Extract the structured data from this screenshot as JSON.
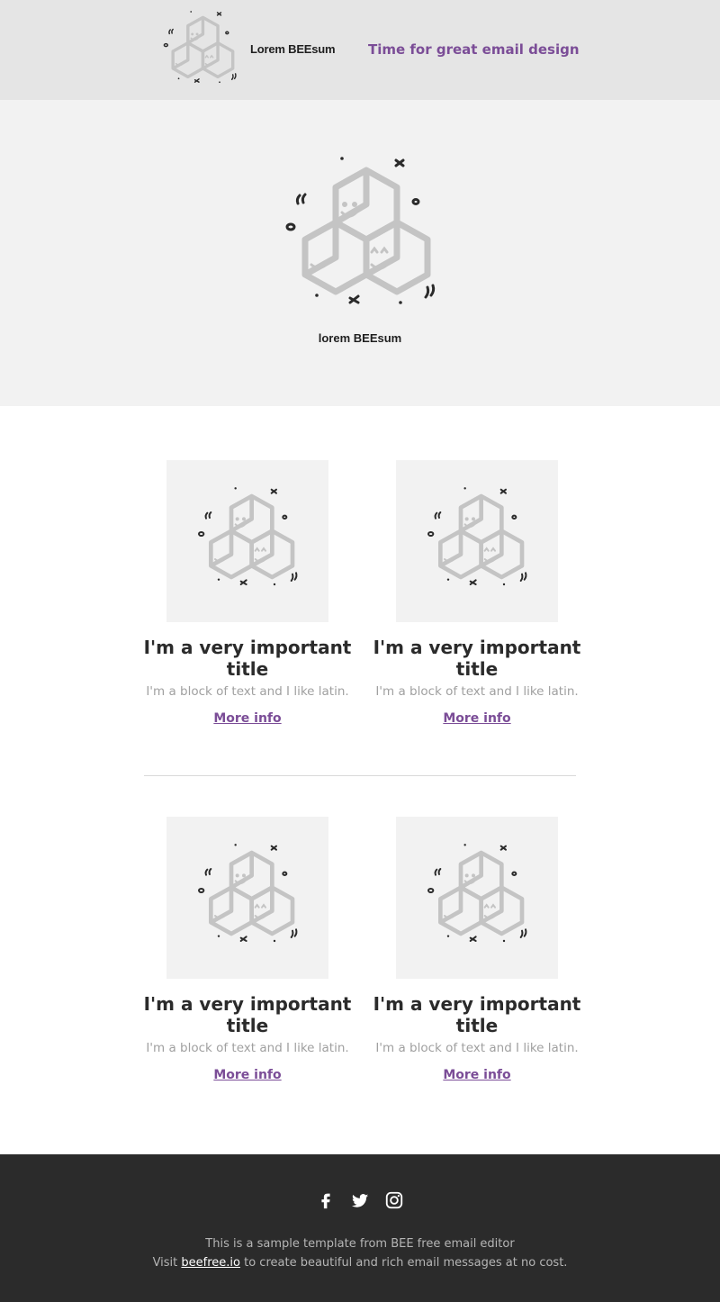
{
  "header": {
    "brand": "Lorem BEEsum",
    "tagline": "Time for great email design",
    "logo_icon": "cube-smiley-logo-icon"
  },
  "hero": {
    "brand": "lorem BEEsum",
    "logo_icon": "cube-smiley-logo-icon"
  },
  "cards": [
    {
      "title": "I'm a very important title",
      "text": "I'm a block of text and I like latin.",
      "link": "More info",
      "image_icon": "cube-smiley-icon"
    },
    {
      "title": "I'm a very important title",
      "text": "I'm a block of text and I like latin.",
      "link": "More info",
      "image_icon": "cube-smiley-icon"
    },
    {
      "title": "I'm a very important title",
      "text": "I'm a block of text and I like latin.",
      "link": "More info",
      "image_icon": "cube-smiley-icon"
    },
    {
      "title": "I'm a very important title",
      "text": "I'm a block of text and I like latin.",
      "link": "More info",
      "image_icon": "cube-smiley-icon"
    }
  ],
  "footer": {
    "social": [
      "facebook-icon",
      "twitter-icon",
      "instagram-icon"
    ],
    "line1": "This is a sample template from BEE free email editor",
    "line2_prefix": "Visit ",
    "line2_link": "beefree.io",
    "line2_suffix": " to create beautiful and rich email messages at no cost."
  },
  "colors": {
    "accent": "#7b4d97",
    "header_bg": "#e5e5e5",
    "hero_bg": "#f2f2f2",
    "footer_bg": "#2b2b2b",
    "text_muted": "#a0a0a0"
  }
}
